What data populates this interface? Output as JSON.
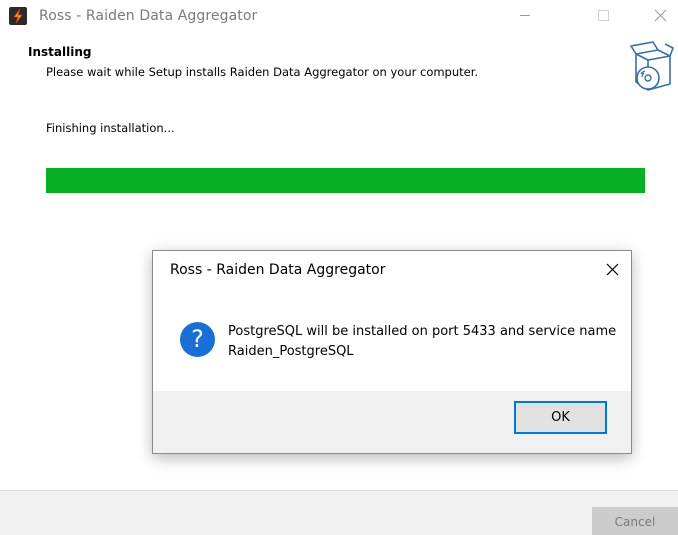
{
  "window": {
    "title": "Ross - Raiden Data Aggregator",
    "icons": {
      "app": "lightning-app-icon",
      "minimize": "minimize-icon",
      "maximize": "maximize-icon",
      "close": "close-icon"
    }
  },
  "header": {
    "title": "Installing",
    "subtitle": "Please wait while Setup installs Raiden Data Aggregator on your computer.",
    "icon": "install-box-disc-icon"
  },
  "install": {
    "status_text": "Finishing installation...",
    "progress": 1.0,
    "progress_color": "#06b025"
  },
  "footer": {
    "cancel_label": "Cancel"
  },
  "dialog": {
    "title": "Ross - Raiden Data Aggregator",
    "icon_glyph": "?",
    "icon": "question-icon",
    "message_line1": "PostgreSQL will be installed on port 5433 and service name",
    "message_line2": "Raiden_PostgreSQL",
    "ok_label": "OK",
    "accent_color": "#0078d7"
  }
}
